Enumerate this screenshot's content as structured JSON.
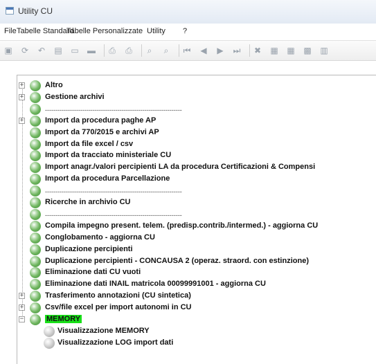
{
  "window": {
    "title": "Utility CU"
  },
  "menu": [
    "File",
    "Tabelle Standard",
    "Tabelle Personalizzate",
    "Utility",
    "?"
  ],
  "toolbar_icons": [
    "save-icon",
    "refresh-icon",
    "undo-icon",
    "chart-icon",
    "new-icon",
    "folder-icon",
    "print-icon",
    "print-preview-icon",
    "find-icon",
    "find-next-icon",
    "first-icon",
    "prev-icon",
    "next-icon",
    "last-icon",
    "delete-icon",
    "export-icon",
    "grid-icon",
    "settings-icon",
    "more-icon"
  ],
  "tree": {
    "items": [
      {
        "label": "Altro",
        "expander": "+",
        "type": "node"
      },
      {
        "label": "Gestione archivi",
        "expander": "+",
        "type": "node"
      },
      {
        "label": "------------------------------------------------------------------",
        "type": "separator"
      },
      {
        "label": "Import da procedura paghe AP",
        "expander": "+",
        "type": "node"
      },
      {
        "label": "Import da 770/2015 e archivi AP",
        "type": "leaf"
      },
      {
        "label": "Import da file excel / csv",
        "type": "leaf"
      },
      {
        "label": "Import da tracciato ministeriale CU",
        "type": "leaf"
      },
      {
        "label": "Import anagr./valori percipienti LA da procedura Certificazioni & Compensi",
        "type": "leaf"
      },
      {
        "label": "Import da procedura Parcellazione",
        "type": "leaf"
      },
      {
        "label": "------------------------------------------------------------------",
        "type": "separator"
      },
      {
        "label": "Ricerche in archivio CU",
        "type": "leaf"
      },
      {
        "label": "------------------------------------------------------------------",
        "type": "separator"
      },
      {
        "label": "Compila impegno present. telem. (predisp.contrib./intermed.) - aggiorna CU",
        "type": "leaf"
      },
      {
        "label": "Conglobamento - aggiorna CU",
        "type": "leaf"
      },
      {
        "label": "Duplicazione percipienti",
        "type": "leaf"
      },
      {
        "label": "Duplicazione percipienti - CONCAUSA 2 (operaz. straord. con estinzione)",
        "type": "leaf"
      },
      {
        "label": "Eliminazione dati CU vuoti",
        "type": "leaf"
      },
      {
        "label": "Eliminazione dati INAIL matricola 00099991001 - aggiorna CU",
        "type": "leaf"
      },
      {
        "label": "Trasferimento annotazioni (CU sintetica)",
        "expander": "+",
        "type": "node"
      },
      {
        "label": "Csv/file excel per import autonomi in CU",
        "expander": "+",
        "type": "node"
      },
      {
        "label": "MEMORY",
        "expander": "−",
        "type": "node",
        "highlight": true
      },
      {
        "label": "Visualizzazione MEMORY",
        "type": "child"
      },
      {
        "label": "Visualizzazione LOG import dati",
        "type": "child"
      }
    ]
  },
  "colors": {
    "highlight": "#19e019",
    "globe": "#6fb55f"
  }
}
